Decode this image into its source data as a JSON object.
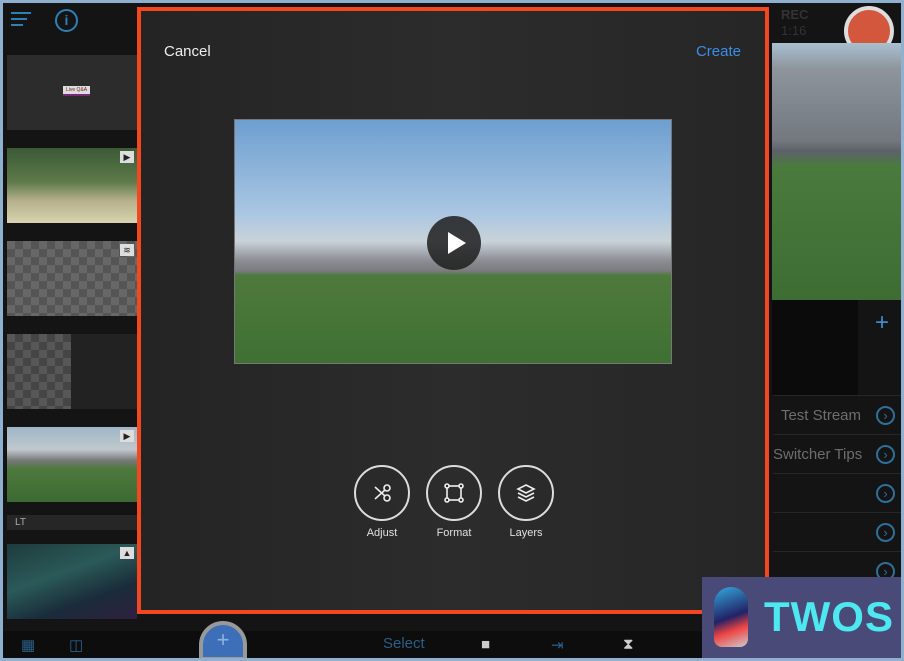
{
  "header": {
    "menu_icon": "hamburger-icon",
    "info_icon": "info-icon",
    "rec_label": "REC",
    "rec_time": "1:16"
  },
  "sidebar": {
    "section_label": "LT",
    "lower_third_text": "Live Q&A"
  },
  "modal": {
    "cancel_label": "Cancel",
    "create_label": "Create",
    "tools": [
      {
        "label": "Adjust",
        "icon": "scissors-icon"
      },
      {
        "label": "Format",
        "icon": "crop-frame-icon"
      },
      {
        "label": "Layers",
        "icon": "layers-icon"
      }
    ]
  },
  "right_panel": {
    "rows": [
      "Test Stream",
      "Switcher Tips",
      "",
      "",
      ""
    ]
  },
  "bottom_bar": {
    "select_label": "Select"
  },
  "watermark": {
    "text": "TWOS"
  },
  "colors": {
    "accent": "#3a8ee6",
    "modal_border": "#f4471f",
    "record": "#d2573c"
  }
}
